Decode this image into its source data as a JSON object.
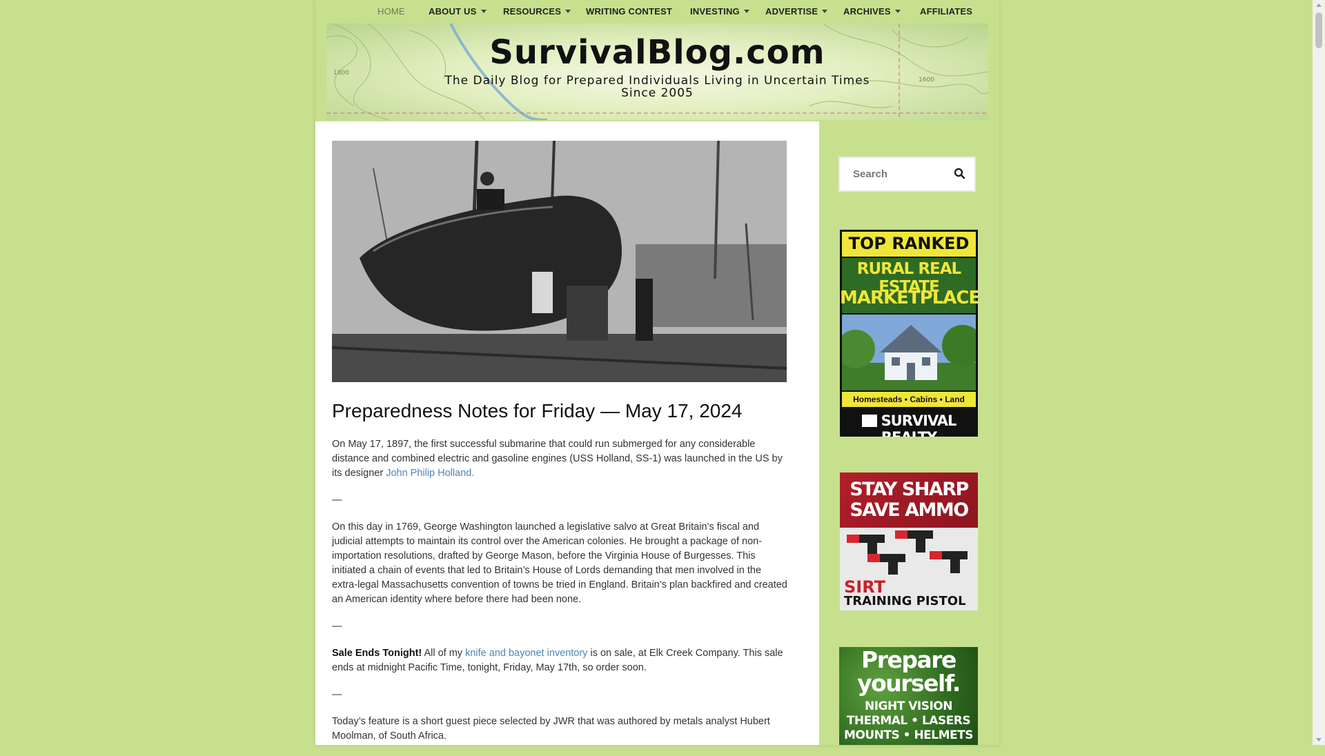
{
  "nav": {
    "items": [
      {
        "label": "HOME",
        "active": true,
        "dropdown": false
      },
      {
        "label": "ABOUT US",
        "dropdown": true
      },
      {
        "label": "RESOURCES",
        "dropdown": true
      },
      {
        "label": "WRITING CONTEST",
        "dropdown": false
      },
      {
        "label": "INVESTING",
        "dropdown": true
      },
      {
        "label": "ADVERTISE",
        "dropdown": true
      },
      {
        "label": "ARCHIVES",
        "dropdown": true
      },
      {
        "label": "AFFILIATES",
        "dropdown": false
      }
    ]
  },
  "header": {
    "title": "SurvivalBlog.com",
    "tagline_line1": "The Daily Blog for Prepared Individuals Living in Uncertain Times",
    "tagline_line2": "Since 2005",
    "map_labels": [
      "1600",
      "1800"
    ]
  },
  "post": {
    "hero_icon": "submarine-photo",
    "title": "Preparedness Notes for Friday — May 17, 2024",
    "p1_text": "On May 17, 1897, the first successful submarine that could run submerged for any considerable distance and combined electric and gasoline engines (USS Holland, SS-1) was launched in the US by its designer ",
    "p1_link": "John Philip Holland.",
    "sep": "—",
    "p2_text": "On this day in 1769, George Washington launched a legislative salvo at Great Britain’s fiscal and judicial attempts to maintain its control over the American colonies. He brought a package of non-importation resolutions, drafted by George Mason, before the Virginia House of Burgesses. This initiated a chain of events that led to Britain’s House of Lords demanding that men involved in the extra-legal Massachusetts convention of towns be tried in England. Britain’s plan backfired and created an American identity where before there had been none.",
    "p3_bold": "Sale Ends Tonight!",
    "p3_pre": " All of my ",
    "p3_link": "knife and bayonet inventory",
    "p3_post": " is on sale, at Elk Creek Company. This sale ends at midnight Pacific Time, tonight, Friday, May 17th, so order soon.",
    "p4_text": "Today’s feature is a short guest piece selected by JWR  that was authored by metals analyst Hubert Moolman, of South Africa."
  },
  "sidebar": {
    "search_placeholder": "Search",
    "search_icon": "magnifier",
    "ad1": {
      "top": "TOP RANKED",
      "line1": "RURAL REAL ESTATE",
      "line2": "MARKETPLACE",
      "tags": "Homesteads • Cabins • Land",
      "brand": "SURVIVAL REALTY",
      "colors": {
        "yellow": "#f0e63a",
        "green": "#2e6b25",
        "black": "#111111"
      }
    },
    "ad2": {
      "line1": "STAY SHARP",
      "line2": "SAVE AMMO",
      "brand": "SIRT",
      "sub": "TRAINING PISTOL"
    },
    "ad3": {
      "line1": "Prepare",
      "line2": "yourself.",
      "line3": "NIGHT VISION",
      "line4": "THERMAL • LASERS",
      "line5": "MOUNTS • HELMETS"
    }
  },
  "colors": {
    "page_bg": "#c7e08e",
    "link": "#4a86b8",
    "nav_active": "#6b7d55"
  }
}
